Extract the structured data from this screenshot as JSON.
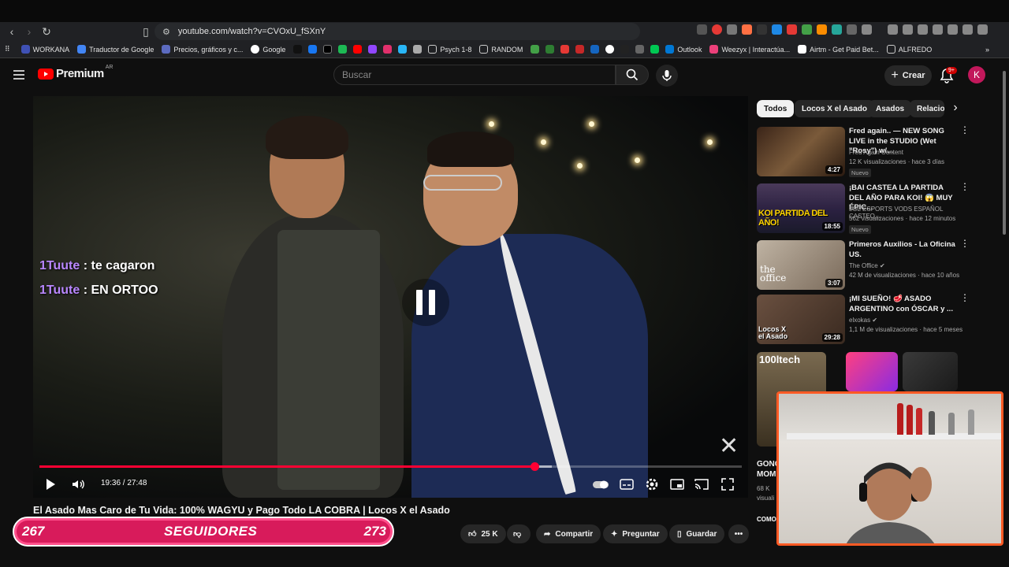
{
  "browser": {
    "url": "youtube.com/watch?v=CVOxU_fSXnY",
    "bookmarks": [
      "WORKANA",
      "Traductor de Google",
      "Precios, gráficos y c...",
      "Google",
      "Psych 1-8",
      "RANDOM",
      "Outlook",
      "Weezyx | Interactúa...",
      "Airtm - Get Paid Bet...",
      "ALFREDO"
    ]
  },
  "youtube": {
    "logo_text": "Premium",
    "logo_country": "AR",
    "search_placeholder": "Buscar",
    "create_label": "Crear",
    "notifications_badge": "9+",
    "avatar_letter": "K"
  },
  "player": {
    "chat": [
      {
        "user": "1Tuute",
        "message": ": te cagaron"
      },
      {
        "user": "1Tuute",
        "message": ": EN ORTOO"
      }
    ],
    "time": "19:36 / 27:48",
    "progress_fraction": 0.7049,
    "buffer_fraction": 0.73
  },
  "video": {
    "title": "El Asado Mas Caro de Tu Vida: 100% WAGYU y Pago Todo LA COBRA | Locos X el Asado",
    "likes": "25 K",
    "share_label": "Compartir",
    "ask_label": "Preguntar",
    "save_label": "Guardar"
  },
  "followers_overlay": {
    "current": "267",
    "label": "SEGUIDORES",
    "goal": "273"
  },
  "filters": [
    "Todos",
    "Locos X el Asado",
    "Asados",
    "Relacio"
  ],
  "recommendations": [
    {
      "title": "Fred again.. — NEW SONG LIVE in the STUDIO (Wet \"Rosy\") w/...",
      "channel": "Fred Again Content",
      "meta": "12 K visualizaciones · hace 3 días",
      "duration": "4:27",
      "badge": "Nuevo",
      "thumb_color": "#5a3a2a"
    },
    {
      "title": "¡BAI CASTEA LA PARTIDA DEL AÑO PARA KOI! 😱 MUY ÉPIC...",
      "channel": "LOL ESPORTS VODS ESPAÑOL CASTEO...",
      "meta": "562 visualizaciones · hace 12 minutos",
      "duration": "18:55",
      "badge": "Nuevo",
      "thumb_text": "KOI PARTIDA DEL AÑO!",
      "thumb_color": "#3a2d4a"
    },
    {
      "title": "Primeros Auxilios - La Oficina US.",
      "channel": "The Office",
      "meta": "42 M de visualizaciones · hace 10 años",
      "duration": "3:07",
      "thumb_text": "the office",
      "thumb_color": "#9c8c7a"
    },
    {
      "title": "¡MI SUEÑO! 🥩 ASADO ARGENTINO con ÓSCAR y ...",
      "channel": "elxokas",
      "meta": "1,1 M de visualizaciones · hace 5 meses",
      "duration": "29:28",
      "thumb_text": "Locos X el Asado",
      "thumb_color": "#6a4a30"
    }
  ],
  "partial_rec": {
    "title_1": "GONC",
    "title_2": "MOM",
    "meta": "68 K",
    "meta2": "visuali",
    "thumb_text": "100ltech",
    "thumb_text2": "COMO"
  }
}
